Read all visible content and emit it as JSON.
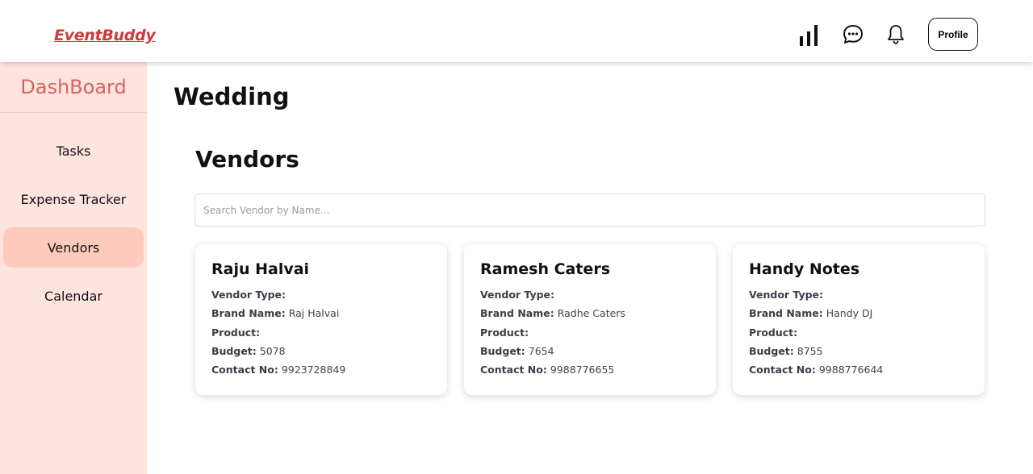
{
  "app": {
    "logo": "EventBuddy"
  },
  "header": {
    "profile_label": "Profile"
  },
  "sidebar": {
    "title": "DashBoard",
    "items": [
      {
        "label": "Tasks"
      },
      {
        "label": "Expense Tracker"
      },
      {
        "label": "Vendors",
        "active": true
      },
      {
        "label": "Calendar"
      }
    ]
  },
  "main": {
    "event_title": "Wedding",
    "section_title": "Vendors",
    "search": {
      "placeholder": "Search Vendor by Name...",
      "value": ""
    },
    "labels": {
      "vendor_type": "Vendor Type:",
      "brand_name": "Brand Name:",
      "product": "Product:",
      "budget": "Budget:",
      "contact": "Contact No:"
    },
    "vendors": [
      {
        "name": "Raju Halvai",
        "vendor_type": "",
        "brand_name": "Raj Halvai",
        "product": "",
        "budget": "5078",
        "contact": "9923728849"
      },
      {
        "name": "Ramesh Caters",
        "vendor_type": "",
        "brand_name": "Radhe Caters",
        "product": "",
        "budget": "7654",
        "contact": "9988776655"
      },
      {
        "name": "Handy Notes",
        "vendor_type": "",
        "brand_name": "Handy DJ",
        "product": "",
        "budget": "8755",
        "contact": "9988776644"
      }
    ]
  },
  "icons": [
    "bar-chart-icon",
    "chat-icon",
    "bell-icon"
  ],
  "colors": {
    "brand": "#d13a3a",
    "sidebar_bg": "#fee4df",
    "active_item": "#fecabd",
    "sidebar_title": "#dc6262"
  }
}
